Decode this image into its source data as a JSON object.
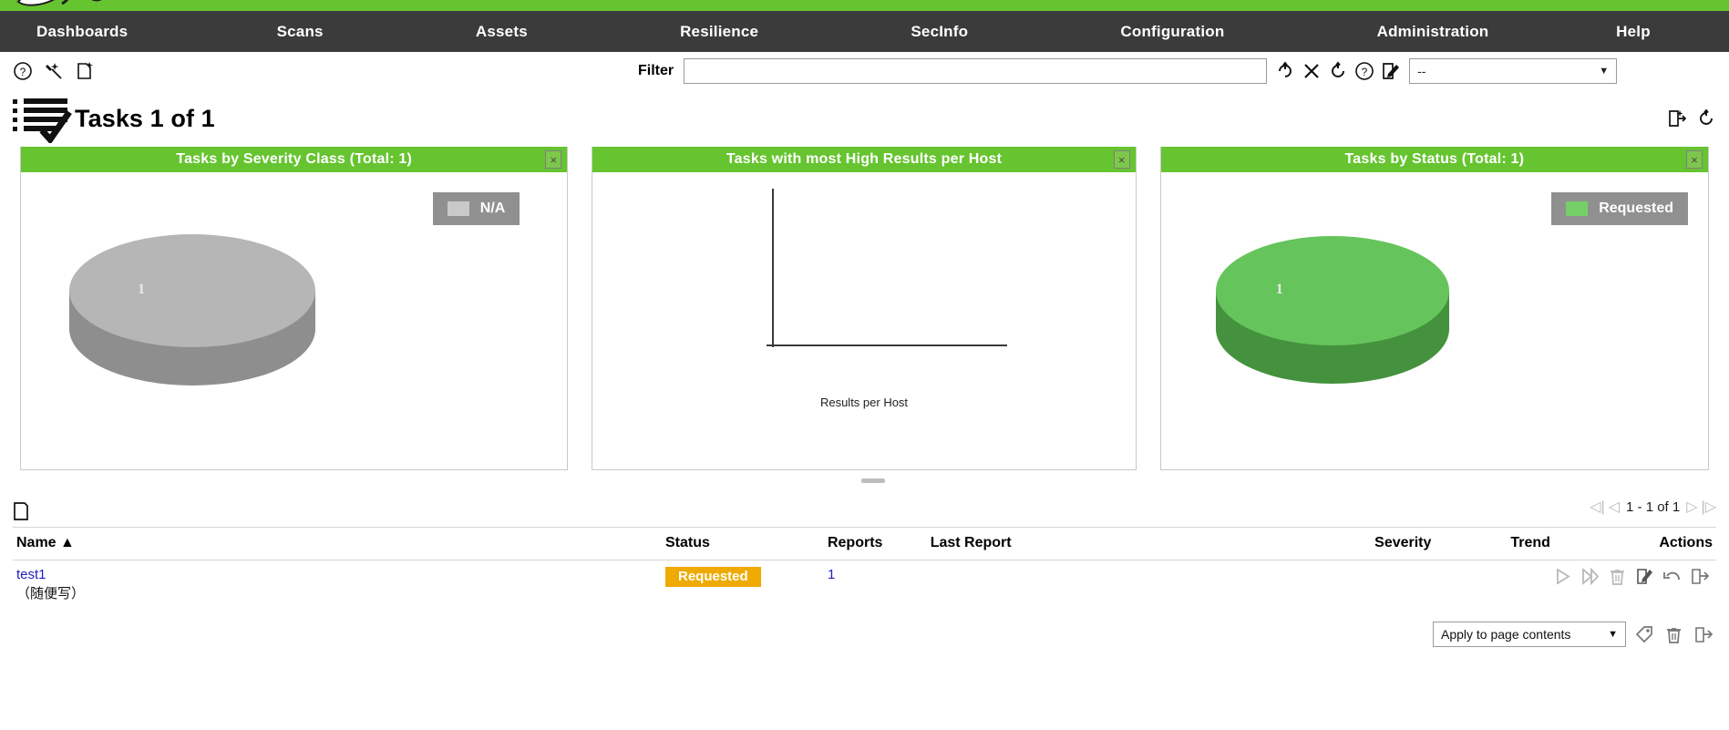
{
  "brand": {
    "accent_green": "#66c430",
    "navbar_bg": "#3b3b3b",
    "status_orange": "#eeaa00",
    "link_blue": "#2020c0",
    "legend_bg": "#909090"
  },
  "nav": {
    "items": [
      {
        "label": "Dashboards"
      },
      {
        "label": "Scans"
      },
      {
        "label": "Assets"
      },
      {
        "label": "Resilience"
      },
      {
        "label": "SecInfo"
      },
      {
        "label": "Configuration"
      },
      {
        "label": "Administration"
      },
      {
        "label": "Help"
      }
    ]
  },
  "toolbar": {
    "icons": [
      {
        "name": "help-icon",
        "title": "Help"
      },
      {
        "name": "wizard-icon",
        "title": "Wizard"
      },
      {
        "name": "new-task-icon",
        "title": "New Task"
      }
    ],
    "filter_label": "Filter",
    "filter_value": "",
    "filter_placeholder": "",
    "filter_actions": [
      {
        "name": "update-filter-icon",
        "title": "Update Filter"
      },
      {
        "name": "remove-filter-icon",
        "title": "Remove Filter"
      },
      {
        "name": "reset-filter-icon",
        "title": "Reset Filter"
      },
      {
        "name": "filter-help-icon",
        "title": "Help: Powerfilter"
      },
      {
        "name": "edit-filter-icon",
        "title": "Edit Filter"
      }
    ],
    "filter_select_value": "--"
  },
  "heading": {
    "title": "Tasks 1 of 1",
    "icon": "task-list-icon",
    "right_icons": [
      {
        "name": "export-icon",
        "title": "Export"
      },
      {
        "name": "refresh-icon",
        "title": "Refresh"
      }
    ]
  },
  "dashboards": [
    {
      "title": "Tasks by Severity Class (Total: 1)",
      "close_label": "×",
      "chart_index": 0
    },
    {
      "title": "Tasks with most High Results per Host",
      "close_label": "×",
      "chart_index": 1
    },
    {
      "title": "Tasks by Status (Total: 1)",
      "close_label": "×",
      "chart_index": 2
    }
  ],
  "chart_data": [
    {
      "type": "pie",
      "title": "Tasks by Severity Class (Total: 1)",
      "total": 1,
      "slices": [
        {
          "label": "N/A",
          "value": 1,
          "color": "#b6b6b6",
          "side_color": "#8e8e8e",
          "data_label": "1"
        }
      ],
      "legend": [
        {
          "label": "N/A",
          "color": "#c9c9c9"
        }
      ],
      "legend_position": "top-right",
      "three_d": true
    },
    {
      "type": "bar",
      "title": "Tasks with most High Results per Host",
      "categories": [],
      "values": [],
      "xlabel": "Results per Host",
      "ylabel": "",
      "grid": false,
      "empty": true
    },
    {
      "type": "pie",
      "title": "Tasks by Status (Total: 1)",
      "total": 1,
      "slices": [
        {
          "label": "Requested",
          "value": 1,
          "color": "#66c45c",
          "side_color": "#44923d",
          "data_label": "1"
        }
      ],
      "legend": [
        {
          "label": "Requested",
          "color": "#76d068"
        }
      ],
      "legend_position": "top-right",
      "three_d": true
    }
  ],
  "table": {
    "new_icon": "new-folder-icon",
    "pagination": {
      "first_label": "◁|",
      "prev_label": "◁",
      "range_text": "1 - 1 of 1",
      "next_label": "▷",
      "last_label": "|▷"
    },
    "columns": [
      {
        "key": "name",
        "label": "Name",
        "sort": "▲"
      },
      {
        "key": "status",
        "label": "Status"
      },
      {
        "key": "reports",
        "label": "Reports"
      },
      {
        "key": "last",
        "label": "Last Report"
      },
      {
        "key": "severity",
        "label": "Severity"
      },
      {
        "key": "trend",
        "label": "Trend"
      },
      {
        "key": "actions",
        "label": "Actions"
      }
    ],
    "rows": [
      {
        "name": "test1",
        "name_sub": "（随便写）",
        "status": "Requested",
        "reports": "1",
        "last_report": "",
        "severity": "",
        "trend": "",
        "actions": [
          {
            "name": "start-task-icon",
            "title": "Start"
          },
          {
            "name": "resume-task-icon",
            "title": "Resume"
          },
          {
            "name": "delete-task-icon",
            "title": "Move to Trashcan"
          },
          {
            "name": "edit-task-icon",
            "title": "Edit Task"
          },
          {
            "name": "clone-task-icon",
            "title": "Clone"
          },
          {
            "name": "export-task-icon",
            "title": "Export Task"
          }
        ]
      }
    ],
    "footer": {
      "apply_label": "Apply to page contents",
      "icons": [
        {
          "name": "bulk-tag-icon",
          "title": "Add tag to page contents"
        },
        {
          "name": "bulk-delete-icon",
          "title": "Move page contents to trashcan"
        },
        {
          "name": "bulk-export-icon",
          "title": "Export page contents"
        }
      ]
    }
  }
}
